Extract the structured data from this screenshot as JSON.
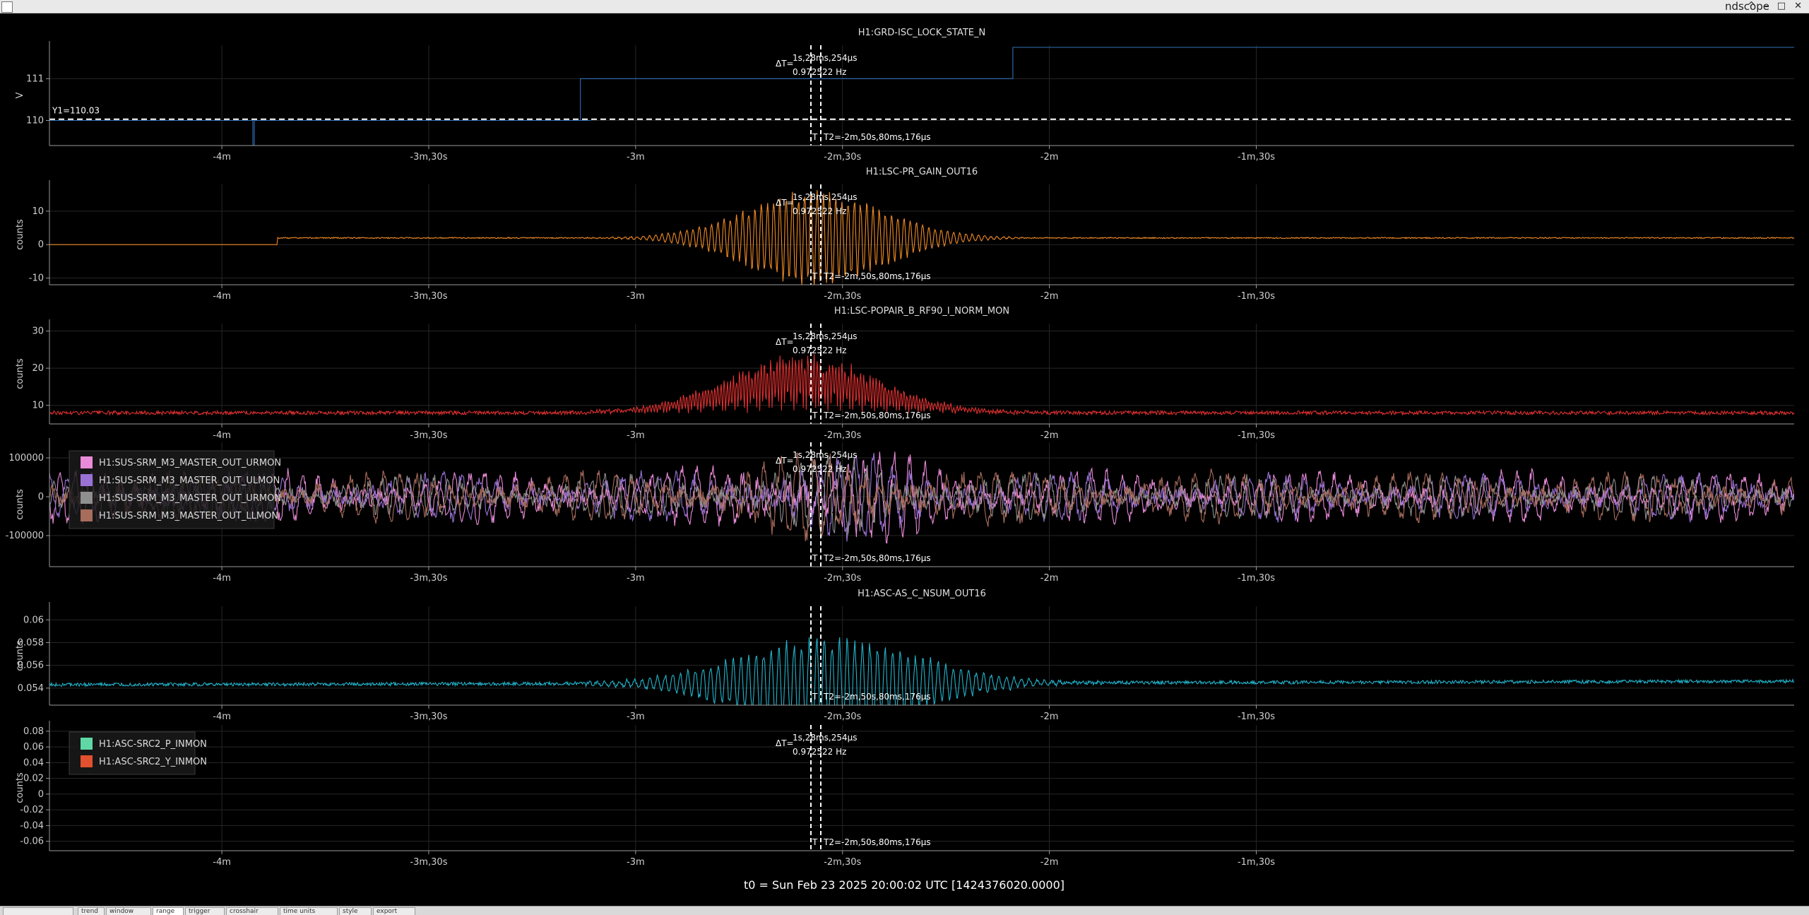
{
  "window": {
    "title": "ndscope",
    "controls": "^ – □ ✕"
  },
  "t0_label": "t0 = Sun Feb 23 2025 20:00:02 UTC [1424376020.0000]",
  "cursors": {
    "dt": "ΔT=",
    "dt_value": "1s,28ms,254µs",
    "freq": "0.972522 Hz",
    "t_label": "T",
    "t2_label": "T2=-2m,50s,80ms,176µs",
    "y1_label": "Y1=110.03"
  },
  "tabs": [
    "",
    "trend",
    "window",
    "range",
    "trigger",
    "crosshair",
    "time units",
    "style",
    "export"
  ],
  "colors": {
    "background": "#000000",
    "grid": "#262626",
    "axis": "#9a9a9a",
    "cursor": "#ffffff"
  },
  "chart_data": [
    {
      "type": "line",
      "title": "H1:GRD-ISC_LOCK_STATE_N",
      "ylabel": "V",
      "xlim": [
        -265,
        -12
      ],
      "ylim": [
        109.4,
        111.8
      ],
      "yticks": [
        110,
        111
      ],
      "xticks": [
        -240,
        -210,
        -180,
        -150,
        -120,
        -90
      ],
      "xtick_labels": [
        "-4m",
        "-3m,30s",
        "-3m",
        "-2m,30s",
        "-2m",
        "-1m,30s"
      ],
      "series": [
        {
          "name": "",
          "color": "#2f6fb6",
          "x": [
            -265,
            -235.5,
            -235.5,
            -235.3,
            -235.3,
            -186.7,
            -186.7,
            -186.5,
            -186.5,
            -188.0,
            -188.0,
            -125.3,
            -125.3,
            -12
          ],
          "y": [
            110,
            110,
            109.4,
            109.4,
            110,
            110,
            110,
            110,
            110,
            110,
            111,
            111,
            111.75,
            111.75
          ]
        }
      ],
      "hline": {
        "y": 110.03,
        "label": "Y1=110.03"
      }
    },
    {
      "type": "line",
      "title": "H1:LSC-PR_GAIN_OUT16",
      "ylabel": "counts",
      "xlim": [
        -265,
        -12
      ],
      "ylim": [
        -12,
        18
      ],
      "yticks": [
        -10,
        0,
        10
      ],
      "xticks": [
        -240,
        -210,
        -180,
        -150,
        -120,
        -90
      ],
      "xtick_labels": [
        "-4m",
        "-3m,30s",
        "-3m",
        "-2m,30s",
        "-2m",
        "-1m,30s"
      ],
      "series": [
        {
          "name": "",
          "color": "#f08a24",
          "approximate": true,
          "baseline": {
            "before_x": -232,
            "value_before": 0,
            "value_after": 2
          },
          "burst": {
            "center": -154,
            "width": 10,
            "amplitude": 15,
            "period": 0.9
          },
          "noise": 0.35
        }
      ]
    },
    {
      "type": "line",
      "title": "H1:LSC-POPAIR_B_RF90_I_NORM_MON",
      "ylabel": "counts",
      "xlim": [
        -265,
        -12
      ],
      "ylim": [
        5,
        32
      ],
      "yticks": [
        10,
        20,
        30
      ],
      "xticks": [
        -240,
        -210,
        -180,
        -150,
        -120,
        -90
      ],
      "xtick_labels": [
        "-4m",
        "-3m,30s",
        "-3m",
        "-2m,30s",
        "-2m",
        "-1m,30s"
      ],
      "series": [
        {
          "name": "",
          "color": "#e03030",
          "approximate": true,
          "base": 8,
          "burst": {
            "center": -156,
            "width": 11,
            "amplitude": 16,
            "period": 0.9,
            "positive_only": true
          },
          "noise": 0.5
        }
      ]
    },
    {
      "type": "line",
      "title": "",
      "ylabel": "counts",
      "xlim": [
        -265,
        -12
      ],
      "ylim": [
        -180000,
        140000
      ],
      "yticks": [
        -100000,
        0,
        100000
      ],
      "xticks": [
        -240,
        -210,
        -180,
        -150,
        -120,
        -90
      ],
      "xtick_labels": [
        "-4m",
        "-3m,30s",
        "-3m",
        "-2m,30s",
        "-2m",
        "-1m,30s"
      ],
      "series": [
        {
          "name": "H1:SUS-SRM_M3_MASTER_OUT_URMON",
          "color": "#e98bd8",
          "approximate": true,
          "amplitude": 60000,
          "period": 2.2,
          "phase": 0
        },
        {
          "name": "H1:SUS-SRM_M3_MASTER_OUT_ULMON",
          "color": "#9a72d6",
          "approximate": true,
          "amplitude": 55000,
          "period": 2.6,
          "phase": 1.2
        },
        {
          "name": "H1:SUS-SRM_M3_MASTER_OUT_URMON",
          "color": "#8f8f8f",
          "approximate": true,
          "amplitude": 50000,
          "period": 1.9,
          "phase": 2.1
        },
        {
          "name": "H1:SUS-SRM_M3_MASTER_OUT_LLMON",
          "color": "#a86c5c",
          "approximate": true,
          "amplitude": 58000,
          "period": 2.4,
          "phase": 3.0
        }
      ]
    },
    {
      "type": "line",
      "title": "H1:ASC-AS_C_NSUM_OUT16",
      "ylabel": "counts",
      "xlim": [
        -265,
        -12
      ],
      "ylim": [
        0.0525,
        0.0612
      ],
      "yticks": [
        0.054,
        0.056,
        0.058,
        0.06
      ],
      "ytick_labels": [
        "0.054",
        "0.056",
        "0.058",
        "0.06"
      ],
      "xticks": [
        -240,
        -210,
        -180,
        -150,
        -120,
        -90
      ],
      "xtick_labels": [
        "-4m",
        "-3m,30s",
        "-3m",
        "-2m,30s",
        "-2m",
        "-1m,30s"
      ],
      "series": [
        {
          "name": "",
          "color": "#21b4cc",
          "approximate": true,
          "base": 0.0543,
          "drift": 0.0003,
          "burst": {
            "center": -152,
            "width": 13,
            "amplitude": 0.0042,
            "period": 1.1
          },
          "noise": 0.00015
        }
      ]
    },
    {
      "type": "line",
      "title": "",
      "ylabel": "counts",
      "xlim": [
        -265,
        -12
      ],
      "ylim": [
        -0.072,
        0.088
      ],
      "yticks": [
        -0.06,
        -0.04,
        -0.02,
        0,
        0.02,
        0.04,
        0.06,
        0.08
      ],
      "ytick_labels": [
        "-0.06",
        "-0.04",
        "-0.02",
        "0",
        "0.02",
        "0.04",
        "0.06",
        "0.08"
      ],
      "xticks": [
        -240,
        -210,
        -180,
        -150,
        -120,
        -90
      ],
      "xtick_labels": [
        "-4m",
        "-3m,30s",
        "-3m",
        "-2m,30s",
        "-2m",
        "-1m,30s"
      ],
      "series": [
        {
          "name": "H1:ASC-SRC2_P_INMON",
          "color": "#5fd8a6",
          "approximate": true,
          "amplitude": 0.025,
          "period": 4.5,
          "burst": {
            "center": -150,
            "width": 18,
            "amplitude": 0.055,
            "period": 1.6
          }
        },
        {
          "name": "H1:ASC-SRC2_Y_INMON",
          "color": "#e2512f",
          "approximate": true,
          "amplitude": 0.018,
          "period": 5.5,
          "burst": {
            "center": -150,
            "width": 18,
            "amplitude": 0.03,
            "period": 2.1
          }
        }
      ]
    }
  ]
}
